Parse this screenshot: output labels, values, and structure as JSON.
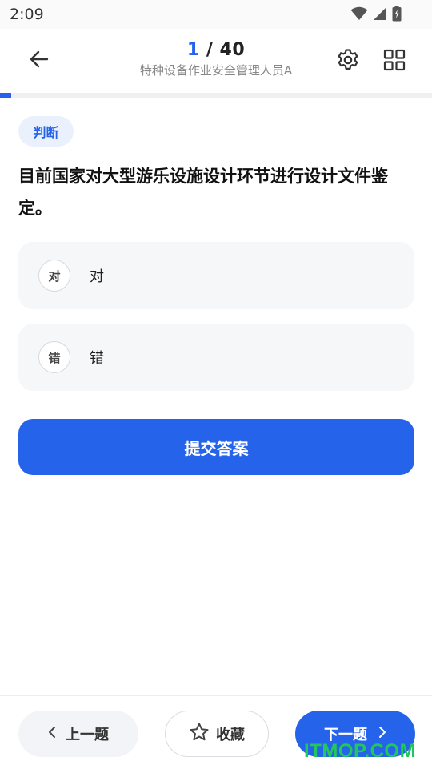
{
  "status_bar": {
    "time": "2:09"
  },
  "header": {
    "progress_current": "1",
    "progress_separator": " / ",
    "progress_total": "40",
    "subtitle": "特种设备作业安全管理人员A"
  },
  "progress": {
    "fraction": 0.025,
    "fill_color": "#2563eb"
  },
  "question": {
    "type_label": "判断",
    "text": "目前国家对大型游乐设施设计环节进行设计文件鉴定。",
    "options": [
      {
        "key": "对",
        "label": "对"
      },
      {
        "key": "错",
        "label": "错"
      }
    ]
  },
  "actions": {
    "submit_label": "提交答案"
  },
  "bottom_nav": {
    "prev_label": "上一题",
    "favorite_label": "收藏",
    "next_label": "下一题"
  },
  "watermark": "ITMOP.COM",
  "colors": {
    "accent": "#2563eb",
    "watermark": "#22c55e"
  },
  "icons": {
    "back": "arrow-left-icon",
    "settings": "gear-icon",
    "grid": "grid-icon",
    "prev": "chevron-left-icon",
    "favorite": "star-outline-icon",
    "next": "chevron-right-icon"
  }
}
